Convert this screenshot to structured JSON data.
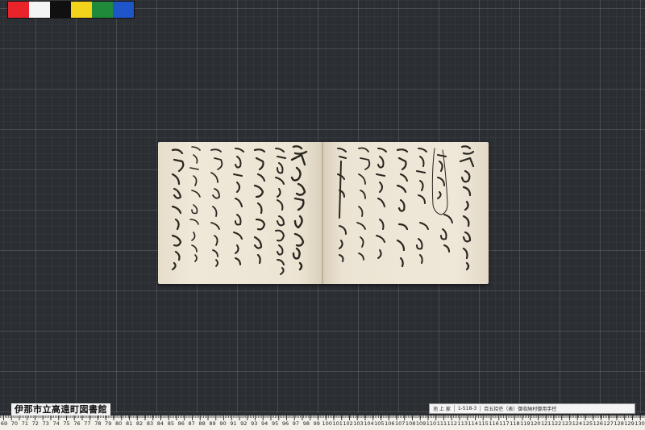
{
  "color_chart": {
    "swatches": [
      {
        "name": "red",
        "color": "#e8232a"
      },
      {
        "name": "white",
        "color": "#f4f4f4"
      },
      {
        "name": "black",
        "color": "#101010"
      },
      {
        "name": "yellow",
        "color": "#f2d21a"
      },
      {
        "name": "green",
        "color": "#1e8a3a"
      },
      {
        "name": "blue",
        "color": "#1e55c8"
      }
    ]
  },
  "library_label": "伊那市立高遠町図書館",
  "catalog_slip": {
    "location": "池 上 家",
    "code": "1-518-3",
    "title": "百五拾壱（表）御収納村御用手控"
  },
  "ruler": {
    "start": 69,
    "end": 130
  },
  "colors": {
    "paper": "#ece4d4",
    "ink": "#2a2620",
    "mat": "#2b2e33"
  }
}
